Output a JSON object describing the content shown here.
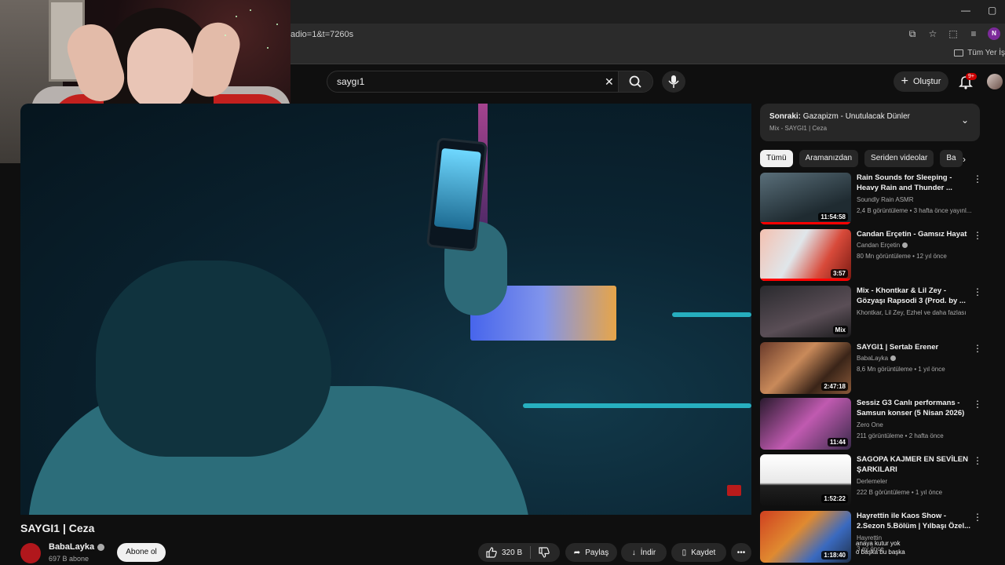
{
  "browser": {
    "url": "adio=1&t=7260s",
    "bookmark_folder": "Tüm Yer İş",
    "profile_initial": "N"
  },
  "header": {
    "search_query": "saygı1",
    "create_label": "Oluştur",
    "notification_badge": "9+"
  },
  "video": {
    "title": "SAYGI1 | Ceza",
    "channel_name": "BabaLayka",
    "channel_subs": "697 B abone",
    "subscribe_label": "Abone ol",
    "like_count": "320 B",
    "share_label": "Paylaş",
    "download_label": "İndir",
    "save_label": "Kaydet"
  },
  "up_next": {
    "prefix": "Sonraki:",
    "title": "Gazapizm - Unutulacak Dünler",
    "subtitle": "Mix - SAYGI1 | Ceza"
  },
  "chips": [
    {
      "label": "Tümü"
    },
    {
      "label": "Aramanızdan"
    },
    {
      "label": "Seriden videolar"
    },
    {
      "label": "Ba"
    }
  ],
  "recommendations": [
    {
      "title": "Rain Sounds for Sleeping - Heavy Rain and Thunder ...",
      "channel": "Soundly Rain ASMR",
      "meta": "2,4 B görüntüleme • 3 hafta önce yayınl...",
      "duration": "11:54:58",
      "verified": false
    },
    {
      "title": "Candan Erçetin - Gamsız Hayat",
      "channel": "Candan Erçetin",
      "meta": "80 Mn görüntüleme • 12 yıl önce",
      "duration": "3:57",
      "verified": true
    },
    {
      "title": "Mix - Khontkar & Lil Zey - Gözyaşı Rapsodi 3 (Prod. by ...",
      "channel": "Khontkar, Lil Zey, Ezhel ve daha fazlası",
      "meta": "",
      "duration": "Mix",
      "verified": false
    },
    {
      "title": "SAYGI1 | Sertab Erener",
      "channel": "BabaLayka",
      "meta": "8,6 Mn görüntüleme • 1 yıl önce",
      "duration": "2:47:18",
      "verified": true
    },
    {
      "title": "Sessiz G3 Canlı performans - Samsun konser (5 Nisan 2026)",
      "channel": "Zero One",
      "meta": "211 görüntüleme • 2 hafta önce",
      "duration": "11:44",
      "verified": false
    },
    {
      "title": "SAGOPA KAJMER EN SEVİLEN ŞARKILARI",
      "channel": "Derlemeler",
      "meta": "222 B görüntüleme • 1 yıl önce",
      "duration": "1:52:22",
      "verified": false
    },
    {
      "title": "Hayrettin ile Kaos Show - 2.Sezon 5.Bölüm | Yılbaşı Özel...",
      "channel": "Hayrettin",
      "meta": "3 ay önce",
      "duration": "1:18:40",
      "verified": false
    }
  ],
  "overlay_chat": {
    "line1": "anaya kutur yok",
    "line2": "o başka bu başka"
  },
  "colors": {
    "background": "#0f0f0f",
    "chip_active": "#f1f1f1",
    "progress": "#ff0000",
    "badge": "#cc0000"
  }
}
